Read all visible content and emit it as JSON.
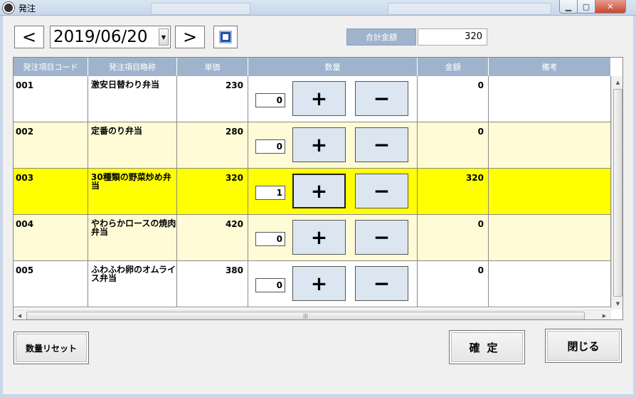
{
  "window": {
    "title": "発注"
  },
  "toolbar": {
    "prev_label": "<",
    "next_label": ">",
    "date": "2019/06/20",
    "dropdown_glyph": "▼",
    "calendar_icon": "calendar-icon"
  },
  "total": {
    "label": "合計金額",
    "value": "320"
  },
  "grid": {
    "headers": {
      "code": "発注項目コード",
      "name": "発注項目略称",
      "price": "単価",
      "qty": "数量",
      "amount": "金額",
      "note": "備考"
    },
    "plus_label": "+",
    "minus_label": "−",
    "rows": [
      {
        "code": "001",
        "name": "激安日替わり弁当",
        "price": "230",
        "qty": "0",
        "amount": "0",
        "note": ""
      },
      {
        "code": "002",
        "name": "定番のり弁当",
        "price": "280",
        "qty": "0",
        "amount": "0",
        "note": ""
      },
      {
        "code": "003",
        "name": "30種類の野菜炒め弁当",
        "price": "320",
        "qty": "1",
        "amount": "320",
        "note": ""
      },
      {
        "code": "004",
        "name": "やわらかロースの焼肉弁当",
        "price": "420",
        "qty": "0",
        "amount": "0",
        "note": ""
      },
      {
        "code": "005",
        "name": "ふわふわ卵のオムライス弁当",
        "price": "380",
        "qty": "0",
        "amount": "0",
        "note": ""
      }
    ],
    "row_colors": [
      "#ffffff",
      "#fffbd6",
      "#ffff00",
      "#fffbd6",
      "#ffffff"
    ]
  },
  "buttons": {
    "reset": "数量リセット",
    "confirm": "確定",
    "close": "閉じる"
  }
}
